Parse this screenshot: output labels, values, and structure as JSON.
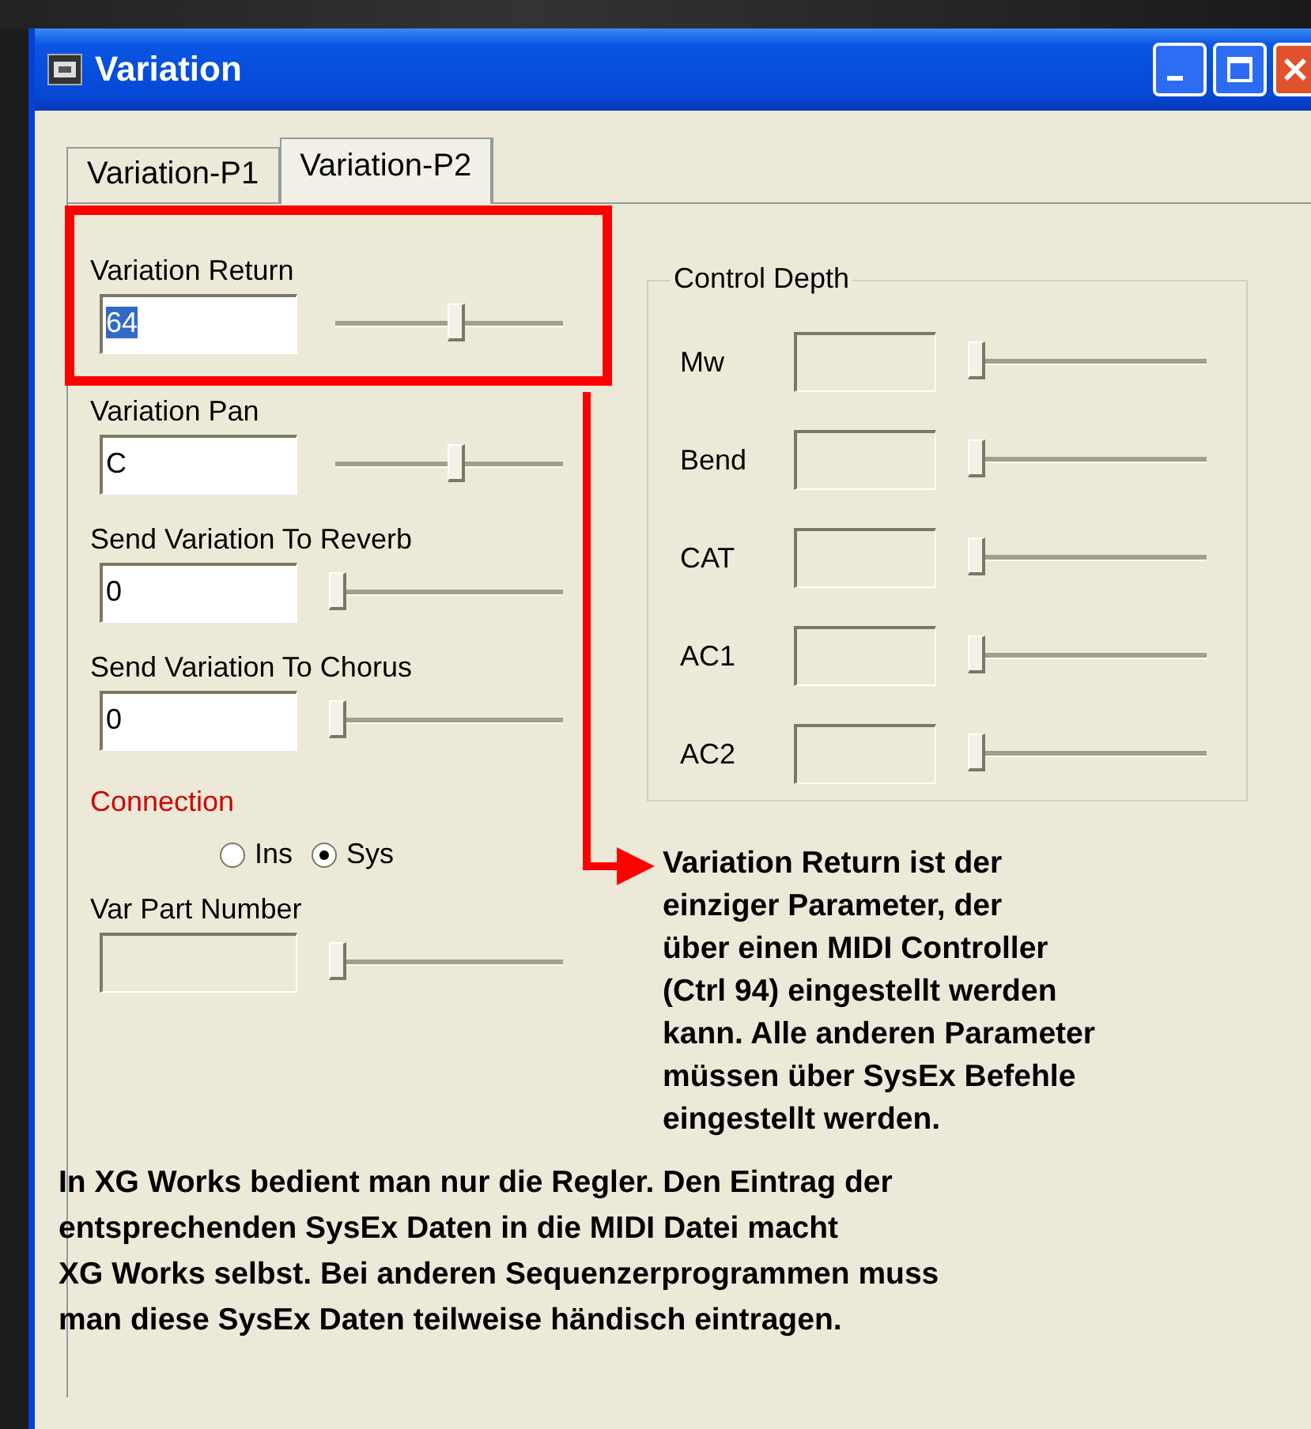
{
  "window": {
    "title": "Variation"
  },
  "tabs": [
    {
      "label": "Variation-P1",
      "selected": false
    },
    {
      "label": "Variation-P2",
      "selected": true
    }
  ],
  "params": [
    {
      "label": "Variation Return",
      "value": "64",
      "highlighted": true,
      "level": 0.53
    },
    {
      "label": "Variation Pan",
      "value": "C",
      "highlighted": false,
      "level": 0.53
    },
    {
      "label": "Send Variation To Reverb",
      "value": "0",
      "highlighted": false,
      "level": 0
    },
    {
      "label": "Send Variation To Chorus",
      "value": "0",
      "highlighted": false,
      "level": 0
    }
  ],
  "connection": {
    "label": "Connection",
    "options": [
      {
        "label": "Ins",
        "selected": false
      },
      {
        "label": "Sys",
        "selected": true
      }
    ]
  },
  "var_part": {
    "label": "Var Part Number",
    "disabled": true,
    "level": 0
  },
  "control_depth": {
    "title": "Control Depth",
    "rows": [
      {
        "label": "Mw",
        "disabled": true,
        "level": 0
      },
      {
        "label": "Bend",
        "disabled": true,
        "level": 0
      },
      {
        "label": "CAT",
        "disabled": true,
        "level": 0
      },
      {
        "label": "AC1",
        "disabled": true,
        "level": 0
      },
      {
        "label": "AC2",
        "disabled": true,
        "level": 0
      }
    ]
  },
  "callout": "Variation Return ist der\neinziger Parameter, der\nüber einen MIDI Controller\n(Ctrl 94) eingestellt werden\nkann. Alle anderen Parameter\nmüssen über SysEx Befehle\neingestellt werden.",
  "note": "In XG Works bedient man nur die Regler. Den Eintrag der\nentsprechenden SysEx Daten in die MIDI Datei macht\nXG Works selbst. Bei anderen Sequenzerprogrammen muss\nman diese SysEx Daten teilweise händisch eintragen."
}
